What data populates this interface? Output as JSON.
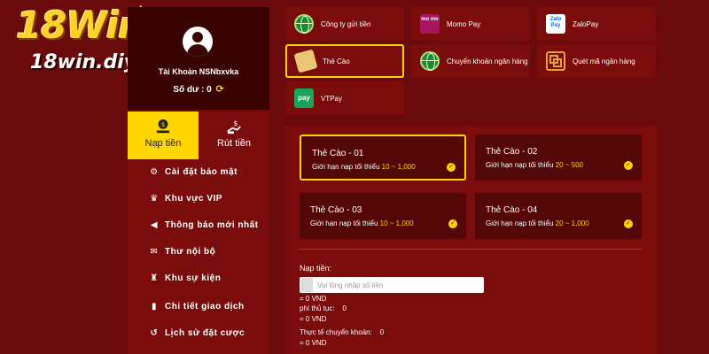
{
  "logo": {
    "main": "18Win",
    "sub": "18win.diy"
  },
  "profile": {
    "account_label": "Tài Khoản NSNbxvka",
    "balance_label": "Số dư :",
    "balance_value": "0"
  },
  "tabs": [
    {
      "label": "Nạp tiền",
      "icon": "deposit-icon",
      "active": true
    },
    {
      "label": "Rút tiền",
      "icon": "withdraw-icon",
      "active": false
    }
  ],
  "menu": [
    {
      "label": "Cài đặt bảo mật",
      "icon": "users-cog-icon"
    },
    {
      "label": "Khu vực VIP",
      "icon": "crown-icon"
    },
    {
      "label": "Thông báo mới nhất",
      "icon": "megaphone-icon"
    },
    {
      "label": "Thư nội bộ",
      "icon": "envelope-icon"
    },
    {
      "label": "Khu sự kiện",
      "icon": "trophy-icon"
    },
    {
      "label": "Chi tiết giao dịch",
      "icon": "file-icon"
    },
    {
      "label": "Lịch sử đặt cược",
      "icon": "history-icon"
    }
  ],
  "payment_methods": [
    {
      "label": "Công ty gửi tiền",
      "icon": "globe-icon"
    },
    {
      "label": "Momo Pay",
      "icon": "momo-icon",
      "icon_text": "mo mo"
    },
    {
      "label": "ZaloPay",
      "icon": "zalopay-icon",
      "icon_text": "Zalo Pay"
    },
    {
      "label": "Thẻ Cào",
      "icon": "scratch-card-icon",
      "selected": true
    },
    {
      "label": "Chuyển khoản ngân hàng",
      "icon": "globe-icon"
    },
    {
      "label": "Quét mã ngân hàng",
      "icon": "qr-code-icon"
    },
    {
      "label": "VTPay",
      "icon": "vtpay-icon",
      "icon_text": "pay"
    }
  ],
  "cards": [
    {
      "title": "Thẻ Cào - 01",
      "limit_label": "Giới hạn nạp tối thiểu",
      "range": "10 ~ 1,000",
      "selected": true
    },
    {
      "title": "Thẻ Cào - 02",
      "limit_label": "Giới hạn nạp tối thiểu",
      "range": "20 ~ 500",
      "selected": false
    },
    {
      "title": "Thẻ Cào - 03",
      "limit_label": "Giới hạn nạp tối thiểu",
      "range": "10 ~ 1,000",
      "selected": false
    },
    {
      "title": "Thẻ Cào - 04",
      "limit_label": "Giới hạn nạp tối thiểu",
      "range": "20 ~ 1,000",
      "selected": false
    }
  ],
  "form": {
    "amount_label": "Nạp tiền:",
    "amount_placeholder": "Vui lòng nhập số tiền",
    "amount_vnd": "= 0 VND",
    "fee_label": "phí thủ tục:",
    "fee_value": "0",
    "fee_vnd": "= 0 VND",
    "actual_label": "Thực tế chuyển khoản:",
    "actual_value": "0",
    "actual_vnd": "= 0 VND"
  },
  "colors": {
    "accent": "#ffd600",
    "panel": "#7a0c0c",
    "background": "#5e0a0a"
  }
}
